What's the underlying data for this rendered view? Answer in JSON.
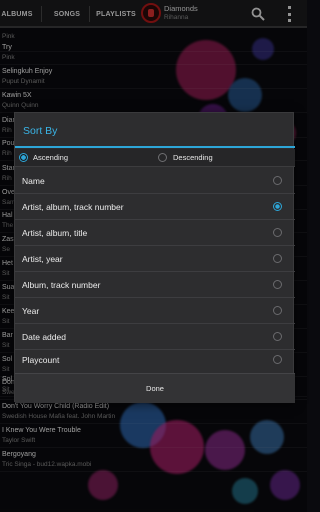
{
  "tabs": [
    {
      "label": "ALBUMS"
    },
    {
      "label": "SONGS"
    },
    {
      "label": "PLAYLISTS"
    }
  ],
  "now_playing": {
    "title": "Diamonds",
    "artist": "Rihanna"
  },
  "songs": [
    {
      "title": "",
      "artist": "Pink"
    },
    {
      "title": "Try",
      "artist": "Pink"
    },
    {
      "title": "Selingkuh Enjoy",
      "artist": "Puput Dynamit"
    },
    {
      "title": "Kawin 5X",
      "artist": "Quinn Quinn"
    },
    {
      "title": "Diam",
      "artist": "Rih"
    },
    {
      "title": "Pou",
      "artist": "Rih"
    },
    {
      "title": "Star",
      "artist": "Rih"
    },
    {
      "title": "Over",
      "artist": "Sam"
    },
    {
      "title": "Hal",
      "artist": "The"
    },
    {
      "title": "Zas",
      "artist": "Se"
    },
    {
      "title": "Het",
      "artist": "Sit"
    },
    {
      "title": "Sua",
      "artist": "Sit"
    },
    {
      "title": "Kee",
      "artist": "Sit"
    },
    {
      "title": "Bar",
      "artist": "Sit"
    },
    {
      "title": "Sol",
      "artist": "Sit"
    },
    {
      "title": "Sol",
      "artist": "Sit"
    },
    {
      "title": "Don",
      "artist": "Swe"
    },
    {
      "title": "Don't You Worry Child (Radio Edit)",
      "artist": "Swedish House Mafia feat. John Martin"
    },
    {
      "title": "I Knew You Were Trouble",
      "artist": "Taylor Swift"
    },
    {
      "title": "Bergoyang",
      "artist": "Tric Singa - bud12.wapka.mobi"
    }
  ],
  "dialog": {
    "title": "Sort By",
    "order": {
      "ascending": "Ascending",
      "descending": "Descending",
      "selected": "ascending"
    },
    "options": [
      {
        "label": "Name",
        "selected": false
      },
      {
        "label": "Artist, album, track number",
        "selected": true
      },
      {
        "label": "Artist, album, title",
        "selected": false
      },
      {
        "label": "Artist, year",
        "selected": false
      },
      {
        "label": "Album, track number",
        "selected": false
      },
      {
        "label": "Year",
        "selected": false
      },
      {
        "label": "Date added",
        "selected": false
      },
      {
        "label": "Playcount",
        "selected": false
      }
    ],
    "done_label": "Done"
  },
  "colors": {
    "accent": "#2da6d8",
    "dialog_bg": "#2d2d2f",
    "now_playing_red": "#b01818"
  },
  "icons": {
    "search": "search-icon",
    "menu": "overflow-menu-icon",
    "now_playing": "now-playing-icon"
  }
}
